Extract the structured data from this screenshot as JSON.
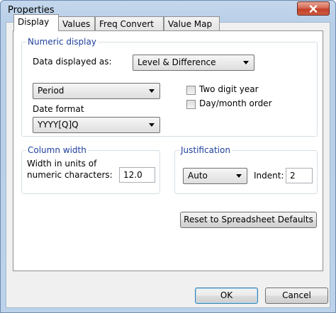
{
  "window": {
    "title": "Properties",
    "close_icon": "close-icon"
  },
  "tabs": [
    {
      "label": "Display",
      "active": true
    },
    {
      "label": "Values",
      "active": false
    },
    {
      "label": "Freq Convert",
      "active": false
    },
    {
      "label": "Value Map",
      "active": false
    }
  ],
  "numeric_display": {
    "title": "Numeric display",
    "data_displayed_label": "Data displayed as:",
    "data_displayed_value": "Level & Difference",
    "period_value": "Period",
    "two_digit_year_label": "Two digit year",
    "two_digit_year_checked": false,
    "day_month_order_label": "Day/month order",
    "day_month_order_checked": false,
    "date_format_label": "Date format",
    "date_format_value": "YYYY[Q]Q"
  },
  "column_width": {
    "title": "Column width",
    "label_line1": "Width in units of",
    "label_line2": "numeric characters:",
    "value": "12.0"
  },
  "justification": {
    "title": "Justification",
    "value": "Auto",
    "indent_label": "Indent:",
    "indent_value": "2"
  },
  "buttons": {
    "reset": "Reset to Spreadsheet Defaults",
    "ok": "OK",
    "cancel": "Cancel"
  }
}
